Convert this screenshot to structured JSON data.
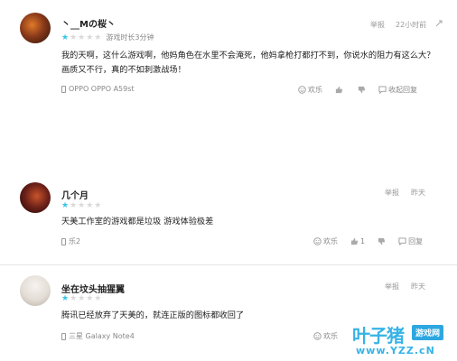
{
  "reviews": [
    {
      "username": "丶__Mの桜丶",
      "rating": 1,
      "playtime": "游戏时长3分钟",
      "report": "举报",
      "time": "22小时前",
      "content": "我的天啊，这什么游戏啊，他妈角色在水里不会淹死，他妈拿枪打都打不到，你说水的阻力有这么大？画质又不行，真的不如刺激战场！",
      "device": "OPPO OPPO A59st",
      "actions": {
        "happy": "欢乐",
        "like_count": "",
        "reply": "收起回复"
      },
      "avatar_color": "#8a3a1a"
    },
    {
      "username": "几个月",
      "rating": 1,
      "playtime": "",
      "report": "举报",
      "time": "昨天",
      "content": "天美工作室的游戏都是垃圾 游戏体验极差",
      "device": "乐2",
      "actions": {
        "happy": "欢乐",
        "like_count": "1",
        "reply": "回复"
      },
      "avatar_color": "#7a2a20"
    },
    {
      "username": "坐在坟头抽猩翼",
      "rating": 1,
      "playtime": "",
      "report": "举报",
      "time": "昨天",
      "content": "腾讯已经放弃了天美的，就连正版的图标都收回了",
      "device": "三星 Galaxy Note4",
      "actions": {
        "happy": "欢乐",
        "like_count": "",
        "reply": ""
      },
      "avatar_color": "#e9e4df"
    }
  ],
  "watermark": {
    "main": "叶子猪",
    "badge": "游戏网",
    "url": "www.YZZ.cN"
  }
}
